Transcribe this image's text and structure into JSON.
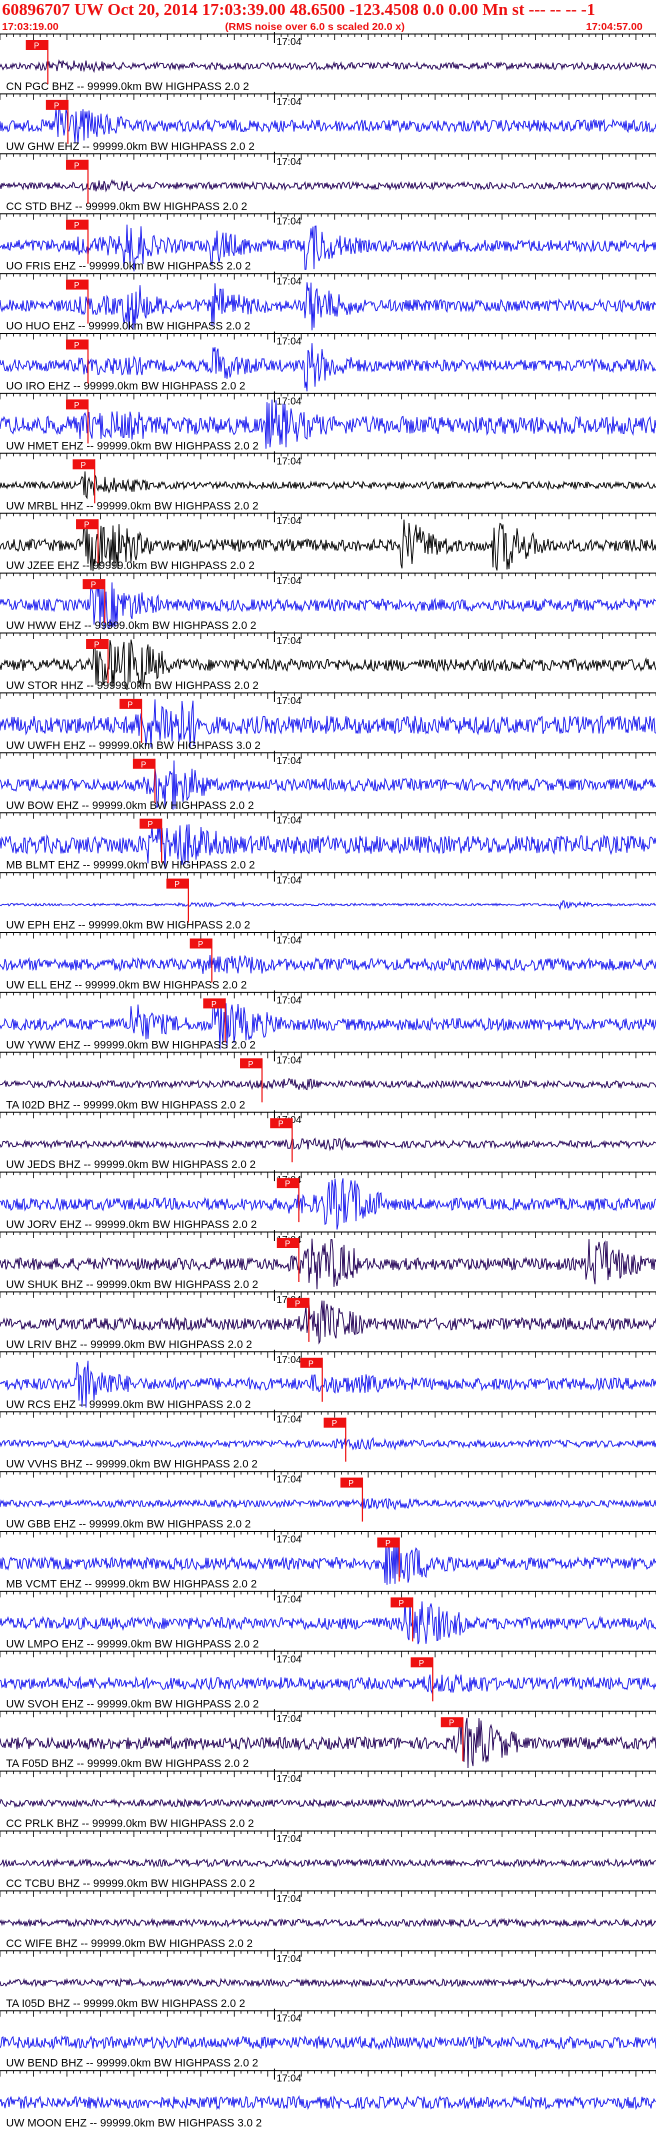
{
  "header": {
    "title": "60896707 UW Oct 20, 2014 17:03:39.00   48.6500 -123.4508  0.0 0.00 Mn st --- -- --   -1",
    "start_time": "17:03:19.00",
    "note": "(RMS noise over 6.0 s scaled 20.0 x)",
    "end_time": "17:04:57.00"
  },
  "colors": {
    "title": "#ee1111",
    "axis": "#000000",
    "blue_trace": "#1a1aee",
    "dark_trace": "#220055",
    "black_trace": "#000000",
    "pick": "#ee1111",
    "pick_fill": "#ee1111"
  },
  "chart_data": {
    "type": "line",
    "title": "60896707 UW Oct 20, 2014 17:03:39.00   48.6500 -123.4508  0.0 0.00 Mn st --- -- --   -1",
    "time_range": [
      "17:03:19.00",
      "17:04:57.00"
    ],
    "tick_label": "17:04",
    "pick_label": "P",
    "series": [
      {
        "name": "CN PGC BHZ -- 99999.0km BW  HIGHPASS  2.0  2",
        "color": "dark",
        "pick_s": 5.5,
        "amp": "low",
        "bursts": []
      },
      {
        "name": "UW GHW EHZ -- 99999.0km BW  HIGHPASS  2.0  2",
        "color": "blue",
        "pick_s": 8.5,
        "amp": "mid",
        "bursts": [
          {
            "t": 8.5,
            "a": 1.0
          }
        ]
      },
      {
        "name": "CC STD BHZ -- 99999.0km BW  HIGHPASS  2.0  2",
        "color": "dark",
        "pick_s": 11.5,
        "amp": "low",
        "bursts": []
      },
      {
        "name": "UO FRIS EHZ -- 99999.0km BW  HIGHPASS  2.0  2",
        "color": "blue",
        "pick_s": 11.5,
        "amp": "mid",
        "bursts": [
          {
            "t": 46,
            "a": 1.3
          },
          {
            "t": 32,
            "a": 0.8
          },
          {
            "t": 19,
            "a": 0.8
          }
        ]
      },
      {
        "name": "UO HUO EHZ -- 99999.0km BW  HIGHPASS  2.0  2",
        "color": "blue",
        "pick_s": 11.5,
        "amp": "mid",
        "bursts": [
          {
            "t": 46,
            "a": 1.4
          },
          {
            "t": 32,
            "a": 0.9
          },
          {
            "t": 19,
            "a": 0.9
          }
        ]
      },
      {
        "name": "UO IRO EHZ -- 99999.0km BW  HIGHPASS  2.0  2",
        "color": "blue",
        "pick_s": 11.5,
        "amp": "mid",
        "bursts": [
          {
            "t": 46,
            "a": 1.2
          },
          {
            "t": 32,
            "a": 0.8
          }
        ]
      },
      {
        "name": "UW HMET EHZ -- 99999.0km BW  HIGHPASS  2.0  2",
        "color": "blue",
        "pick_s": 11.5,
        "amp": "high",
        "bursts": [
          {
            "t": 40,
            "a": 1.2
          }
        ]
      },
      {
        "name": "UW MRBL HHZ -- 99999.0km BW  HIGHPASS  2.0  2",
        "color": "black",
        "pick_s": 12.5,
        "amp": "low",
        "bursts": [
          {
            "t": 12.5,
            "a": 0.6
          }
        ]
      },
      {
        "name": "UW JZEE EHZ -- 99999.0km BW  HIGHPASS  2.0  2",
        "color": "black",
        "pick_s": 13.0,
        "amp": "mid",
        "bursts": [
          {
            "t": 13,
            "a": 2.2
          },
          {
            "t": 60,
            "a": 1.6
          },
          {
            "t": 74,
            "a": 2.0
          }
        ]
      },
      {
        "name": "UW HWW EHZ -- 99999.0km BW  HIGHPASS  2.0  2",
        "color": "blue",
        "pick_s": 14.0,
        "amp": "mid",
        "bursts": [
          {
            "t": 14,
            "a": 1.2
          }
        ]
      },
      {
        "name": "UW STOR HHZ -- 99999.0km BW  HIGHPASS  2.0  2",
        "color": "black",
        "pick_s": 14.5,
        "amp": "mid",
        "bursts": [
          {
            "t": 14.5,
            "a": 1.6
          },
          {
            "t": 17.5,
            "a": 1.4
          }
        ]
      },
      {
        "name": "UW UWFH EHZ -- 99999.0km BW  HIGHPASS  3.0  2",
        "color": "blue",
        "pick_s": 19.5,
        "amp": "high",
        "bursts": [
          {
            "t": 22,
            "a": 2.2
          }
        ]
      },
      {
        "name": "UW BOW EHZ -- 99999.0km BW  HIGHPASS  2.0  2",
        "color": "blue",
        "pick_s": 21.5,
        "amp": "mid",
        "bursts": [
          {
            "t": 23,
            "a": 1.4
          }
        ]
      },
      {
        "name": "MB BLMT EHZ -- 99999.0km BW  HIGHPASS  2.0  2",
        "color": "blue",
        "pick_s": 22.5,
        "amp": "high",
        "bursts": [
          {
            "t": 22.5,
            "a": 1.0
          }
        ]
      },
      {
        "name": "UW EPH EHZ -- 99999.0km BW  HIGHPASS  2.0  2",
        "color": "blue",
        "pick_s": 26.5,
        "amp": "flat",
        "bursts": [
          {
            "t": 84,
            "a": 0.8
          }
        ]
      },
      {
        "name": "UW ELL EHZ -- 99999.0km BW  HIGHPASS  2.0  2",
        "color": "blue",
        "pick_s": 30.0,
        "amp": "mid",
        "bursts": []
      },
      {
        "name": "UW YWW EHZ -- 99999.0km BW  HIGHPASS  2.0  2",
        "color": "blue",
        "pick_s": 32.0,
        "amp": "mid",
        "bursts": [
          {
            "t": 20,
            "a": 1.0
          },
          {
            "t": 32,
            "a": 1.2
          }
        ]
      },
      {
        "name": "TA I02D BHZ -- 99999.0km BW  HIGHPASS  2.0  2",
        "color": "dark",
        "pick_s": 37.5,
        "amp": "low",
        "bursts": []
      },
      {
        "name": "UW JEDS BHZ -- 99999.0km BW  HIGHPASS  2.0  2",
        "color": "dark",
        "pick_s": 42.0,
        "amp": "low",
        "bursts": []
      },
      {
        "name": "UW JORV EHZ -- 99999.0km BW  HIGHPASS  2.0  2",
        "color": "blue",
        "pick_s": 43.0,
        "amp": "mid",
        "bursts": [
          {
            "t": 49,
            "a": 4.0
          }
        ]
      },
      {
        "name": "UW SHUK BHZ -- 99999.0km BW  HIGHPASS  2.0  2",
        "color": "dark",
        "pick_s": 43.0,
        "amp": "mid",
        "bursts": [
          {
            "t": 46,
            "a": 2.2
          },
          {
            "t": 88,
            "a": 2.4
          }
        ]
      },
      {
        "name": "UW LRIV BHZ -- 99999.0km BW  HIGHPASS  2.0  2",
        "color": "dark",
        "pick_s": 44.5,
        "amp": "mid",
        "bursts": [
          {
            "t": 46,
            "a": 1.0
          }
        ]
      },
      {
        "name": "UW RCS EHZ -- 99999.0km BW  HIGHPASS  2.0  2",
        "color": "blue",
        "pick_s": 46.5,
        "amp": "mid",
        "bursts": [
          {
            "t": 12,
            "a": 1.5
          }
        ]
      },
      {
        "name": "UW VVHS BHZ -- 99999.0km BW  HIGHPASS  2.0  2",
        "color": "blue",
        "pick_s": 50.0,
        "amp": "low",
        "bursts": []
      },
      {
        "name": "UW GBB EHZ -- 99999.0km BW  HIGHPASS  2.0  2",
        "color": "blue",
        "pick_s": 52.5,
        "amp": "low",
        "bursts": []
      },
      {
        "name": "MB VCMT EHZ -- 99999.0km BW  HIGHPASS  2.0  2",
        "color": "blue",
        "pick_s": 58.0,
        "amp": "mid",
        "bursts": [
          {
            "t": 58,
            "a": 1.0
          }
        ]
      },
      {
        "name": "UW LMPO EHZ -- 99999.0km BW  HIGHPASS  2.0  2",
        "color": "blue",
        "pick_s": 60.0,
        "amp": "mid",
        "bursts": [
          {
            "t": 61,
            "a": 1.2
          }
        ]
      },
      {
        "name": "UW SVOH EHZ -- 99999.0km BW  HIGHPASS  2.0  2",
        "color": "blue",
        "pick_s": 63.0,
        "amp": "mid",
        "bursts": []
      },
      {
        "name": "TA F05D BHZ -- 99999.0km BW  HIGHPASS  2.0  2",
        "color": "dark",
        "pick_s": 67.5,
        "amp": "mid",
        "bursts": [
          {
            "t": 69,
            "a": 1.3
          }
        ]
      },
      {
        "name": "CC PRLK BHZ -- 99999.0km BW  HIGHPASS  2.0  2",
        "color": "dark",
        "pick_s": null,
        "amp": "low",
        "bursts": []
      },
      {
        "name": "CC TCBU BHZ -- 99999.0km BW  HIGHPASS  2.0  2",
        "color": "dark",
        "pick_s": null,
        "amp": "low",
        "bursts": []
      },
      {
        "name": "CC WIFE BHZ -- 99999.0km BW  HIGHPASS  2.0  2",
        "color": "dark",
        "pick_s": null,
        "amp": "low",
        "bursts": []
      },
      {
        "name": "TA I05D BHZ -- 99999.0km BW  HIGHPASS  2.0  2",
        "color": "dark",
        "pick_s": null,
        "amp": "low",
        "bursts": []
      },
      {
        "name": "UW BEND BHZ -- 99999.0km BW  HIGHPASS  2.0  2",
        "color": "blue",
        "pick_s": null,
        "amp": "mid",
        "bursts": []
      },
      {
        "name": "UW MOON EHZ -- 99999.0km BW  HIGHPASS  3.0  2",
        "color": "blue",
        "pick_s": null,
        "amp": "mid",
        "bursts": []
      }
    ]
  }
}
